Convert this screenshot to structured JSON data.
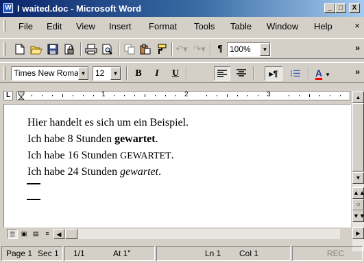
{
  "window": {
    "title": "I waited.doc - Microsoft Word",
    "app_icon": "W",
    "minimize_label": "_",
    "maximize_label": "□",
    "close_label": "X"
  },
  "menu": {
    "items": [
      "File",
      "Edit",
      "View",
      "Insert",
      "Format",
      "Tools",
      "Table",
      "Window",
      "Help"
    ],
    "doc_close": "×"
  },
  "standard_toolbar": {
    "icons": [
      "new-icon",
      "open-icon",
      "save-icon",
      "permission-icon",
      "print-icon",
      "print-preview-icon",
      "copy-icon",
      "paste-icon",
      "format-painter-icon",
      "undo-icon",
      "redo-icon",
      "show-formatting-icon"
    ],
    "zoom": "100%",
    "more": "»"
  },
  "formatting_toolbar": {
    "font": "Times New Roman",
    "size": "12",
    "bold": "B",
    "italic": "I",
    "underline": "U",
    "font_color": "A",
    "accent_color": "#ff0000",
    "more": "»"
  },
  "ruler": {
    "tab_selector": "L",
    "numbers": [
      "1",
      "2",
      "3"
    ]
  },
  "document": {
    "lines": [
      {
        "text": "Hier handelt es sich um ein Beispiel."
      },
      {
        "prefix": "Ich habe 8 Stunden ",
        "emph": "gewartet",
        "suffix": "."
      },
      {
        "prefix": "Ich habe 16 Stunden ",
        "emph": "GEWARTET",
        "suffix": "."
      },
      {
        "prefix": "Ich habe 24 Stunden ",
        "emph": "gewartet",
        "suffix": "."
      }
    ]
  },
  "statusbar": {
    "page": "Page 1",
    "section": "Sec 1",
    "pages": "1/1",
    "at": "At 1\"",
    "line": "Ln 1",
    "col": "Col 1",
    "rec": "REC"
  }
}
